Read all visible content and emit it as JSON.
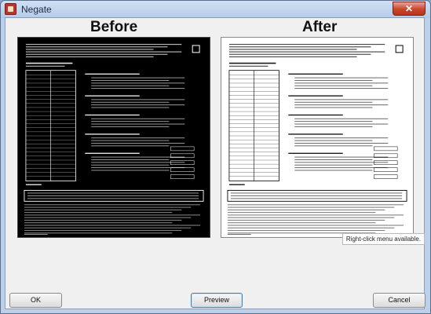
{
  "window": {
    "title": "Negate",
    "close_label": "✕"
  },
  "preview": {
    "before_label": "Before",
    "after_label": "After"
  },
  "hint": "Right-click menu available.",
  "buttons": {
    "ok": "OK",
    "preview": "Preview",
    "cancel": "Cancel"
  },
  "colors": {
    "before_bg": "#000000",
    "before_ink": "#ffffff",
    "after_bg": "#ffffff",
    "after_ink": "#000000",
    "titlebar": "#bcd0ea",
    "close": "#c9452c"
  }
}
